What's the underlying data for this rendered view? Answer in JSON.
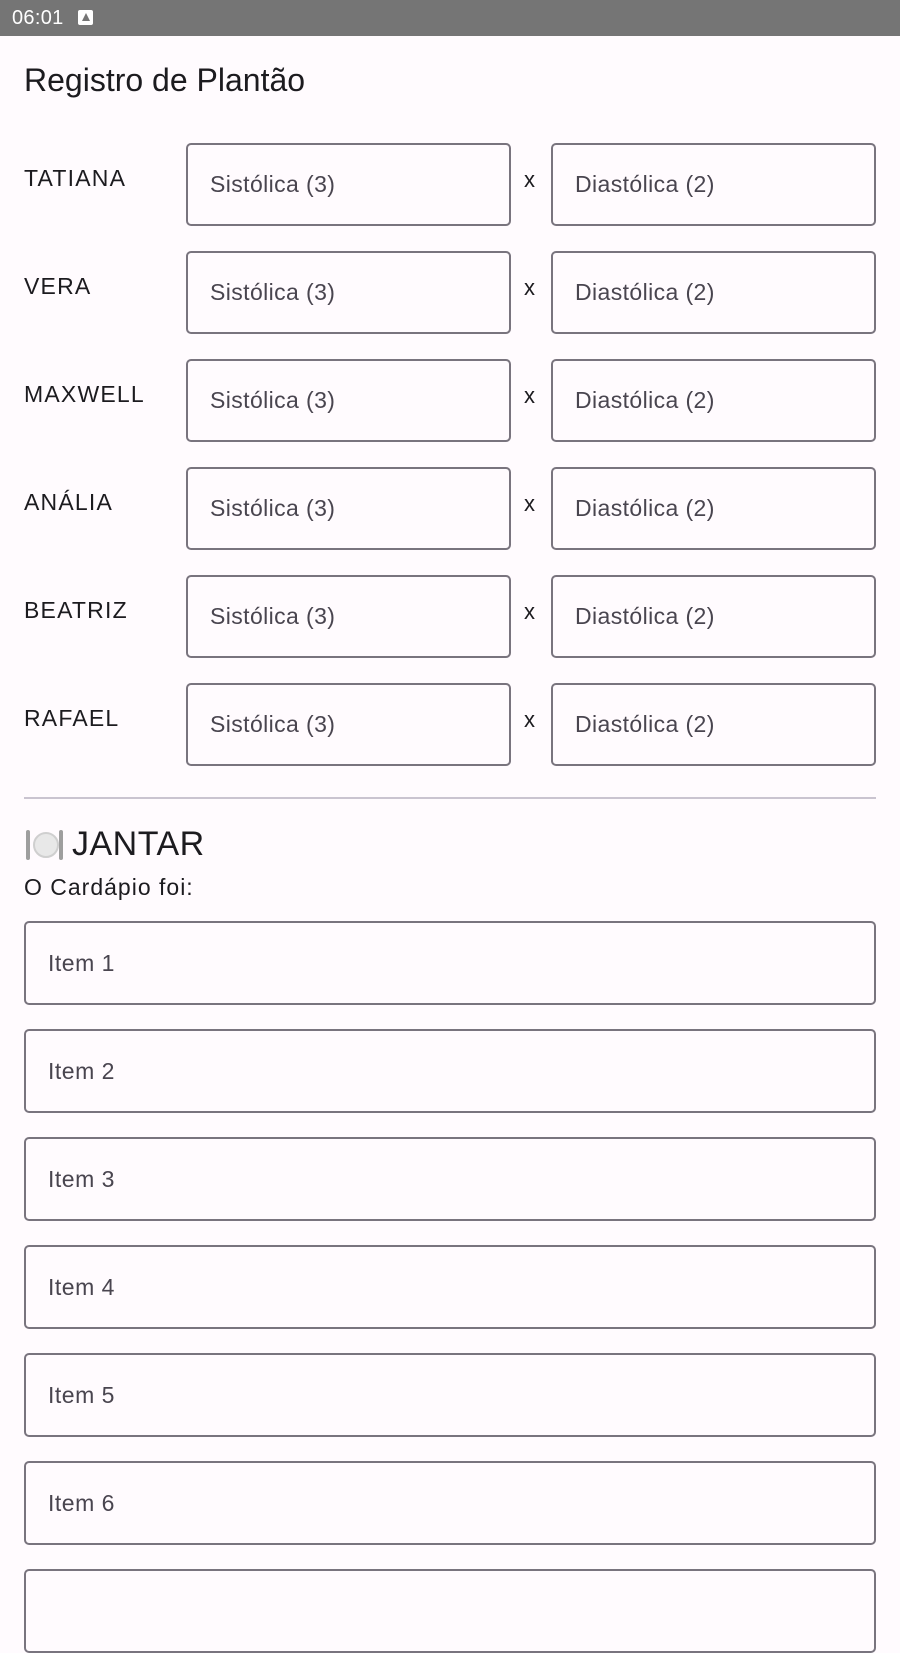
{
  "status_bar": {
    "time": "06:01",
    "notification_icon": "a-letter-icon"
  },
  "page": {
    "title": "Registro de Plantão"
  },
  "blood_pressure": {
    "separator": "x",
    "rows": [
      {
        "name": "TATIANA",
        "systolic_placeholder": "Sistólica (3)",
        "diastolic_placeholder": "Diastólica (2)"
      },
      {
        "name": "VERA",
        "systolic_placeholder": "Sistólica (3)",
        "diastolic_placeholder": "Diastólica (2)"
      },
      {
        "name": "MAXWELL",
        "systolic_placeholder": "Sistólica (3)",
        "diastolic_placeholder": "Diastólica (2)"
      },
      {
        "name": "ANÁLIA",
        "systolic_placeholder": "Sistólica (3)",
        "diastolic_placeholder": "Diastólica (2)"
      },
      {
        "name": "BEATRIZ",
        "systolic_placeholder": "Sistólica (3)",
        "diastolic_placeholder": "Diastólica (2)"
      },
      {
        "name": "RAFAEL",
        "systolic_placeholder": "Sistólica (3)",
        "diastolic_placeholder": "Diastólica (2)"
      }
    ]
  },
  "dinner": {
    "icon": "plate-cutlery-icon",
    "title": "JANTAR",
    "menu_label": "O Cardápio foi:",
    "items": [
      {
        "placeholder": "Item 1"
      },
      {
        "placeholder": "Item 2"
      },
      {
        "placeholder": "Item 3"
      },
      {
        "placeholder": "Item 4"
      },
      {
        "placeholder": "Item 5"
      },
      {
        "placeholder": "Item 6"
      },
      {
        "placeholder": ""
      }
    ]
  },
  "colors": {
    "background": "#fffbfe",
    "status_bar": "#757575",
    "field_border": "#79747e",
    "divider": "#cac4d0",
    "text": "#1c1b1f",
    "placeholder_text": "#49454f"
  }
}
